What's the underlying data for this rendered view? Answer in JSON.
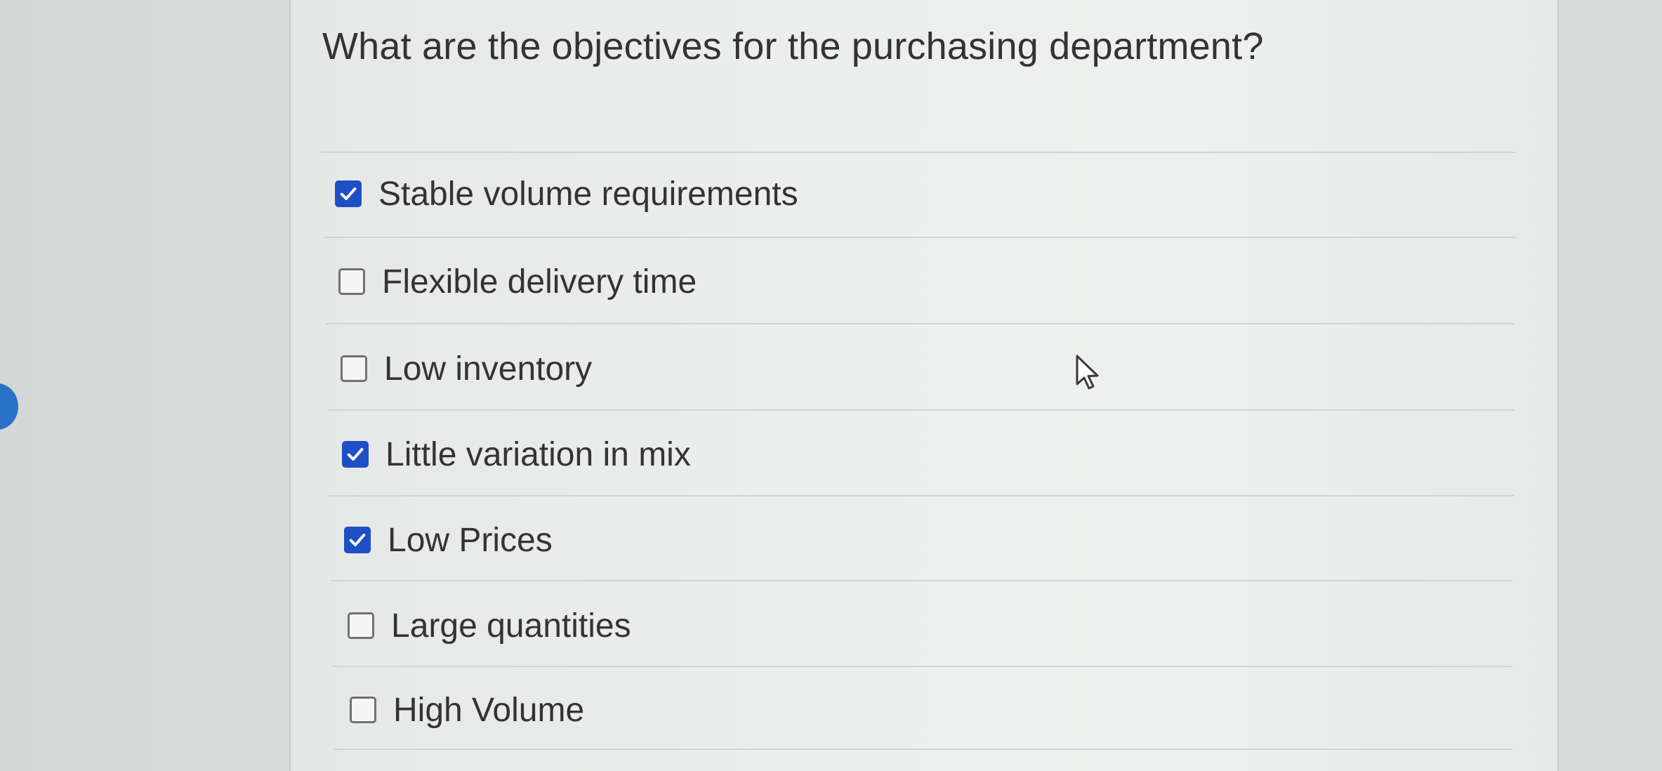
{
  "question": {
    "text": "What are the objectives for the purchasing department?"
  },
  "options": [
    {
      "label": "Stable volume requirements",
      "checked": true
    },
    {
      "label": "Flexible delivery time",
      "checked": false
    },
    {
      "label": "Low inventory",
      "checked": false
    },
    {
      "label": "Little variation in mix",
      "checked": true
    },
    {
      "label": "Low Prices",
      "checked": true
    },
    {
      "label": "Large quantities",
      "checked": false
    },
    {
      "label": "High Volume",
      "checked": false
    }
  ],
  "colors": {
    "checkbox_checked": "#1f4fc6",
    "side_indicator": "#2a72c9"
  }
}
